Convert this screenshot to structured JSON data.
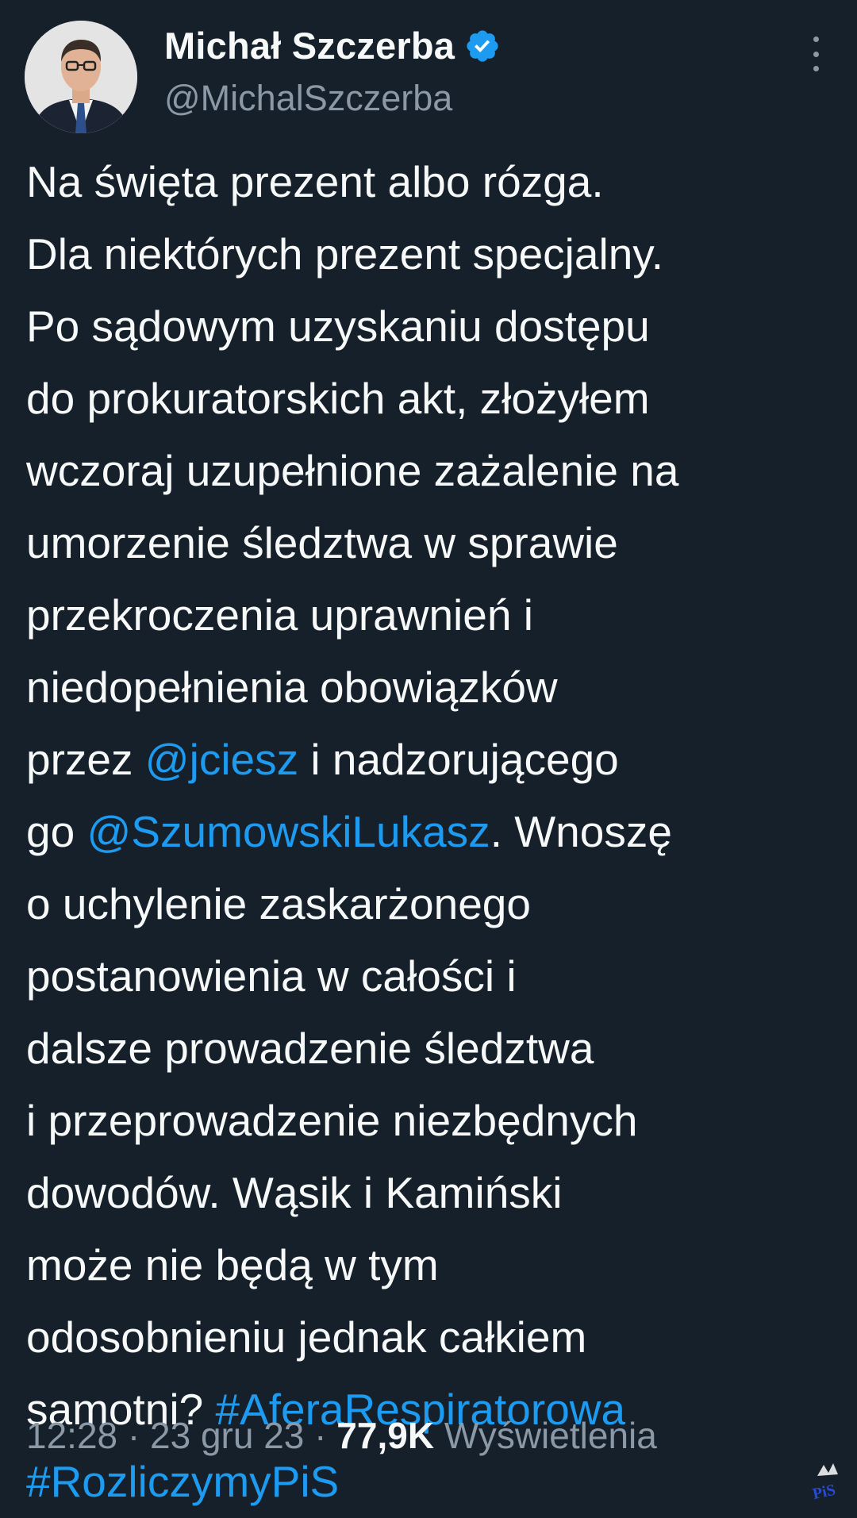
{
  "author": {
    "display_name": "Michał Szczerba",
    "handle": "@MichalSzczerba",
    "verified": true
  },
  "icons": {
    "verified": "verified-badge-icon",
    "more": "more-vertical-icon",
    "watermark": "pis-logo-watermark"
  },
  "tweet": {
    "lines": [
      [
        {
          "t": "Na święta prezent albo rózga."
        }
      ],
      [
        {
          "t": "Dla niektórych prezent specjalny."
        }
      ],
      [
        {
          "t": "Po sądowym uzyskaniu dostępu"
        }
      ],
      [
        {
          "t": "do prokuratorskich akt, złożyłem"
        }
      ],
      [
        {
          "t": "wczoraj uzupełnione zażalenie na"
        }
      ],
      [
        {
          "t": "umorzenie śledztwa w sprawie"
        }
      ],
      [
        {
          "t": "przekroczenia uprawnień i"
        }
      ],
      [
        {
          "t": "niedopełnienia obowiązków"
        }
      ],
      [
        {
          "t": "przez "
        },
        {
          "t": "@jciesz",
          "link": true
        },
        {
          "t": " i nadzorującego"
        }
      ],
      [
        {
          "t": "go "
        },
        {
          "t": "@SzumowskiLukasz",
          "link": true
        },
        {
          "t": ". Wnoszę"
        }
      ],
      [
        {
          "t": "o uchylenie zaskarżonego"
        }
      ],
      [
        {
          "t": "postanowienia w całości i"
        }
      ],
      [
        {
          "t": "dalsze prowadzenie śledztwa"
        }
      ],
      [
        {
          "t": "i przeprowadzenie niezbędnych"
        }
      ],
      [
        {
          "t": "dowodów. Wąsik i Kamiński"
        }
      ],
      [
        {
          "t": "może nie będą w tym"
        }
      ],
      [
        {
          "t": "odosobnieniu jednak całkiem"
        }
      ],
      [
        {
          "t": "samotni? "
        },
        {
          "t": "#AferaRespiratorowa",
          "link": true
        }
      ],
      [
        {
          "t": "#RozliczymyPiS",
          "link": true
        }
      ]
    ]
  },
  "meta": {
    "time": "12:28",
    "sep1": " · ",
    "date": "23 gru 23",
    "sep2": " · ",
    "views_count": "77,9K",
    "views_label": " Wyświetlenia"
  },
  "watermark_text": "PiS",
  "colors": {
    "background": "#15202b",
    "text": "#f7f9f9",
    "secondary": "#8b98a5",
    "link": "#1d9bf0",
    "verified": "#1d9bf0"
  }
}
